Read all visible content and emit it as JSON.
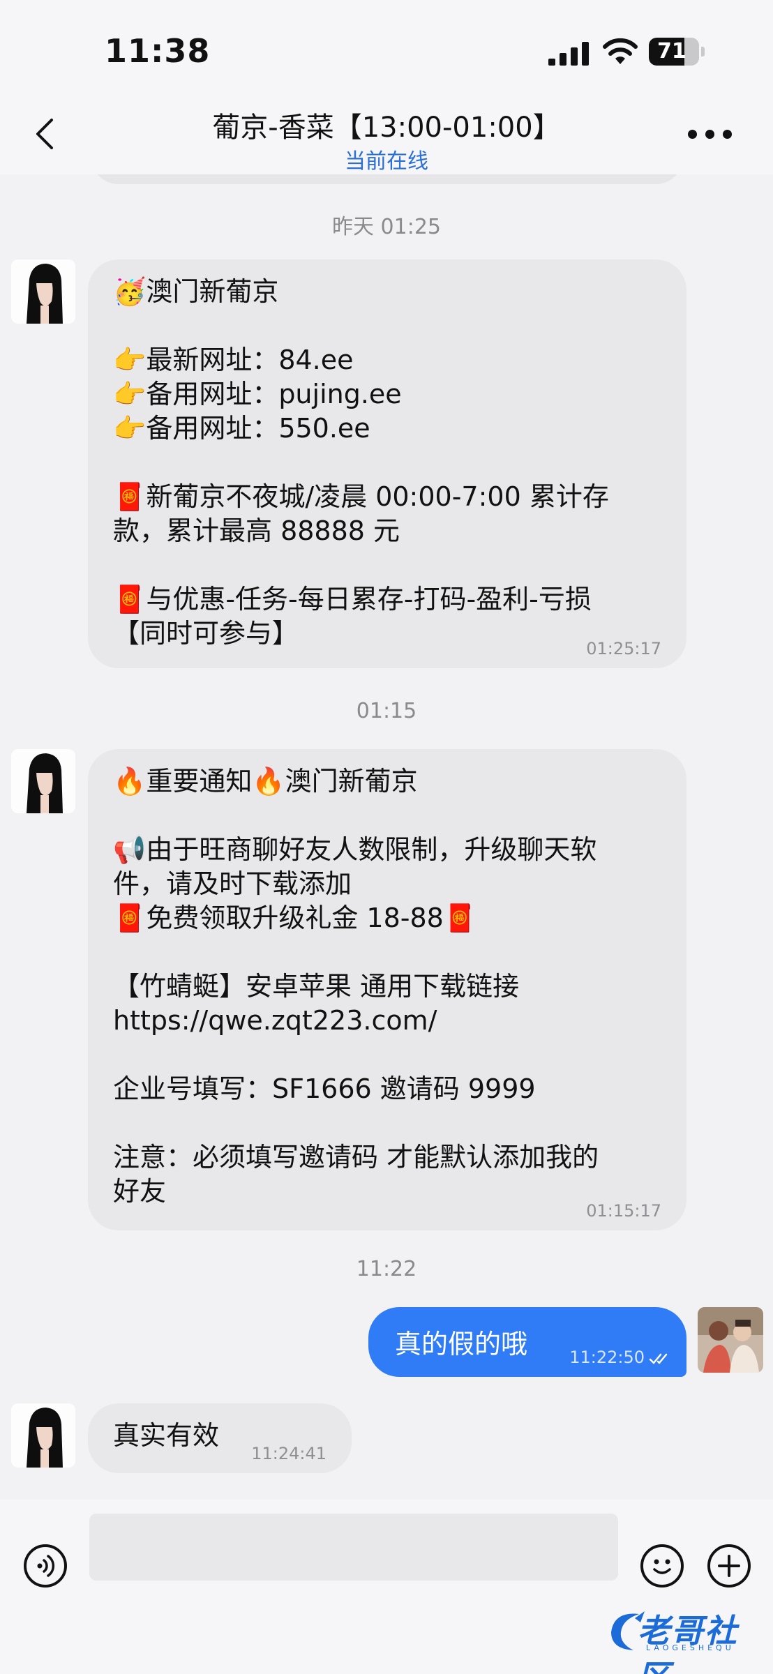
{
  "status_bar": {
    "time": "11:38",
    "battery_percent": "71",
    "battery_level": 0.71
  },
  "header": {
    "back_icon": "chevron-left-icon",
    "title": "葡京-香菜【13:00-01:00】",
    "subtitle": "当前在线",
    "more_icon": "more-dots-icon"
  },
  "messages": [
    {
      "divider": "昨天 01:25",
      "direction": "in",
      "text": "🥳澳门新葡京\n\n👉最新网址：84.ee\n👉备用网址：pujing.ee\n👉备用网址：550.ee\n\n🧧新葡京不夜城/凌晨 00:00-7:00 累计存\n款，累计最高 88888 元\n\n🧧与优惠-任务-每日累存-打码-盈利-亏损\n【同时可参与】",
      "time": "01:25:17"
    },
    {
      "divider": "01:15",
      "direction": "in",
      "text": "🔥重要通知🔥澳门新葡京\n\n📢由于旺商聊好友人数限制，升级聊天软\n件，请及时下载添加\n🧧免费领取升级礼金 18-88🧧\n\n【竹蜻蜓】安卓苹果 通用下载链接\nhttps://qwe.zqt223.com/\n\n企业号填写：SF1666 邀请码 9999\n\n注意：必须填写邀请码 才能默认添加我的\n好友",
      "time": "01:15:17"
    },
    {
      "divider": "11:22",
      "direction": "out",
      "text": "真的假的哦",
      "time": "11:22:50",
      "status_icon": "double-check-icon"
    },
    {
      "direction": "in",
      "text": "真实有效",
      "time": "11:24:41"
    }
  ],
  "input_bar": {
    "voice_icon": "voice-icon",
    "emoji_icon": "emoji-icon",
    "plus_icon": "plus-icon",
    "placeholder": ""
  },
  "watermark": {
    "text": "老哥社区",
    "sub": "LAOGESHEQU"
  },
  "colors": {
    "accent": "#2f7cf6",
    "incoming_bubble": "#e8e8ea",
    "background": "#f2f2f4",
    "link_blue": "#2a6fd6"
  }
}
